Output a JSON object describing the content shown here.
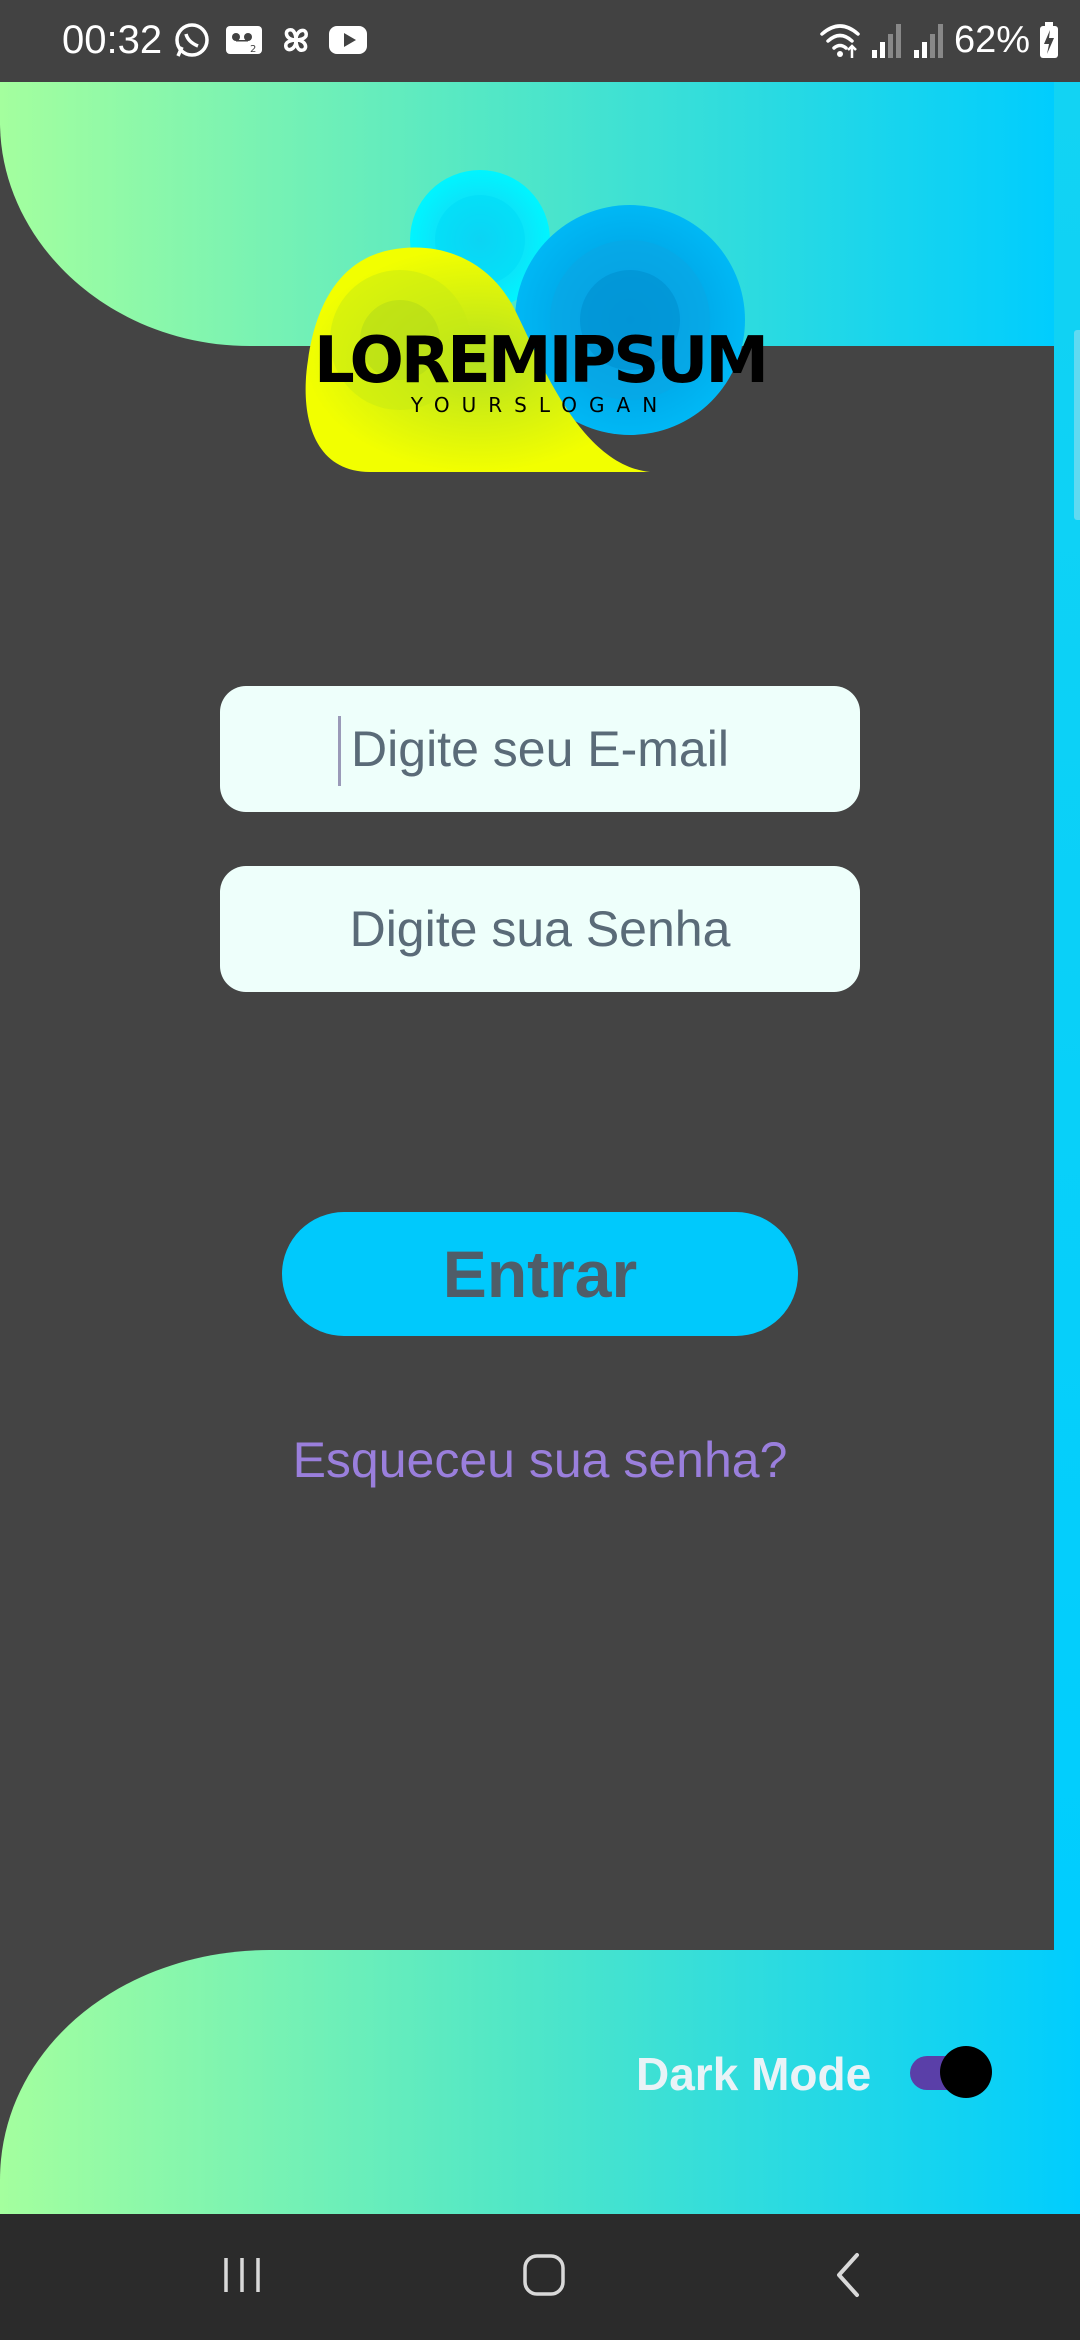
{
  "status_bar": {
    "time": "00:32",
    "battery": "62%",
    "left_icons": [
      "whatsapp-icon",
      "voicemail-icon",
      "pinwheel-icon",
      "youtube-icon"
    ],
    "right_icons": [
      "wifi-icon",
      "signal-icon",
      "signal-icon",
      "battery-charging-icon"
    ]
  },
  "logo": {
    "brand": "LOREMIPSUM",
    "slogan": "YOURSLOGAN"
  },
  "login_form": {
    "email_placeholder": "Digite seu E-mail",
    "password_placeholder": "Digite sua Senha",
    "email_value": "",
    "password_value": "",
    "submit_label": "Entrar",
    "forgot_password_label": "Esqueceu sua senha?"
  },
  "settings": {
    "dark_mode_label": "Dark Mode",
    "dark_mode_enabled": true
  },
  "navigation_bar": {
    "buttons": [
      "recents-icon",
      "home-icon",
      "back-icon"
    ]
  },
  "colors": {
    "background": "#444444",
    "accent_cyan": "#00cdfe",
    "accent_green": "#8ef7a5",
    "button": "#00c9fc",
    "link": "#9a7fdc",
    "toggle_track": "#5a3fa8",
    "input_background": "#eefffb"
  }
}
